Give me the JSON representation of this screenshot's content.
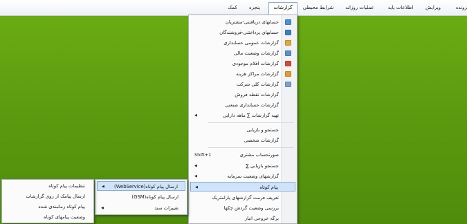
{
  "menubar": {
    "items": [
      {
        "label": "پرونده",
        "active": false
      },
      {
        "label": "ویرایش",
        "active": false
      },
      {
        "label": "اطلاعات پایه",
        "active": false
      },
      {
        "label": "عملیات روزانه",
        "active": false
      },
      {
        "label": "شرایط محیطی",
        "active": false
      },
      {
        "label": "گزارشات",
        "active": true
      },
      {
        "label": "پنجره",
        "active": false
      },
      {
        "label": "کمک",
        "active": false
      }
    ]
  },
  "reports_menu": {
    "items": [
      {
        "label": "حسابهای دریافتنی-مشتریان",
        "icon": "document-icon",
        "icon_color": "#4a8fd6"
      },
      {
        "label": "حسابهای پرداختنی-فروشندگان",
        "icon": "document-icon",
        "icon_color": "#3b7fc7"
      },
      {
        "label": "گزارشات عمومی حسابداری",
        "icon": "ledger-icon",
        "icon_color": "#e0a93a"
      },
      {
        "label": "گزارشات وضعیت مالی",
        "icon": "chart-icon",
        "icon_color": "#5a8fd0"
      },
      {
        "label": "گزارشات اقلام موجودی",
        "icon": "gift-icon",
        "icon_color": "#d9473a"
      },
      {
        "label": "گزارشات مراکز هزینه",
        "icon": "cost-icon",
        "icon_color": "#e39b2f"
      },
      {
        "label": "گزارشات کلی شرکت",
        "icon": "report-icon",
        "icon_color": "#7aa0cf"
      },
      {
        "label": "گزارشات نقطه فروش"
      },
      {
        "label": "گزارشات حسابداری صنعتی"
      },
      {
        "label": "تهیه گزارشات ∑ ماهه دارایی",
        "arrow": true
      },
      {
        "label": "جستجو و بازیابی"
      },
      {
        "label": "گزارشات شخصی"
      },
      {
        "label": "صورتحساب مشتری",
        "shortcut": "Shift+1"
      },
      {
        "label": "جستجو بازیابی ∑",
        "arrow": true
      },
      {
        "label": "گزارشهای وضعیت سرمایه",
        "arrow": true
      },
      {
        "label": "پیام کوتاه",
        "arrow": true,
        "highlighted": true
      },
      {
        "label": "تعریف فرمت گزارشهای پارامتریک"
      },
      {
        "label": "بررسی وضعیت گردش چکها"
      },
      {
        "label": "برگه خروجی انبار"
      }
    ]
  },
  "sms_menu": {
    "items": [
      {
        "label": "ارسال پیام کوتاه(WebService)",
        "arrow": true,
        "highlighted": true
      },
      {
        "label": "ارسال پیام کوتاه(GSM)"
      },
      {
        "label": "تغییرات سند",
        "arrow": true
      }
    ]
  },
  "webservice_menu": {
    "items": [
      {
        "label": "تنظیمات پیام کوتاه"
      },
      {
        "label": "ارسال پیامک از روی گزارشات"
      },
      {
        "label": "پیام کوتاه زمانبندی شده"
      },
      {
        "label": "وضعیت پیامهای کوتاه"
      }
    ]
  },
  "glyphs": {
    "arrow": "◀"
  }
}
